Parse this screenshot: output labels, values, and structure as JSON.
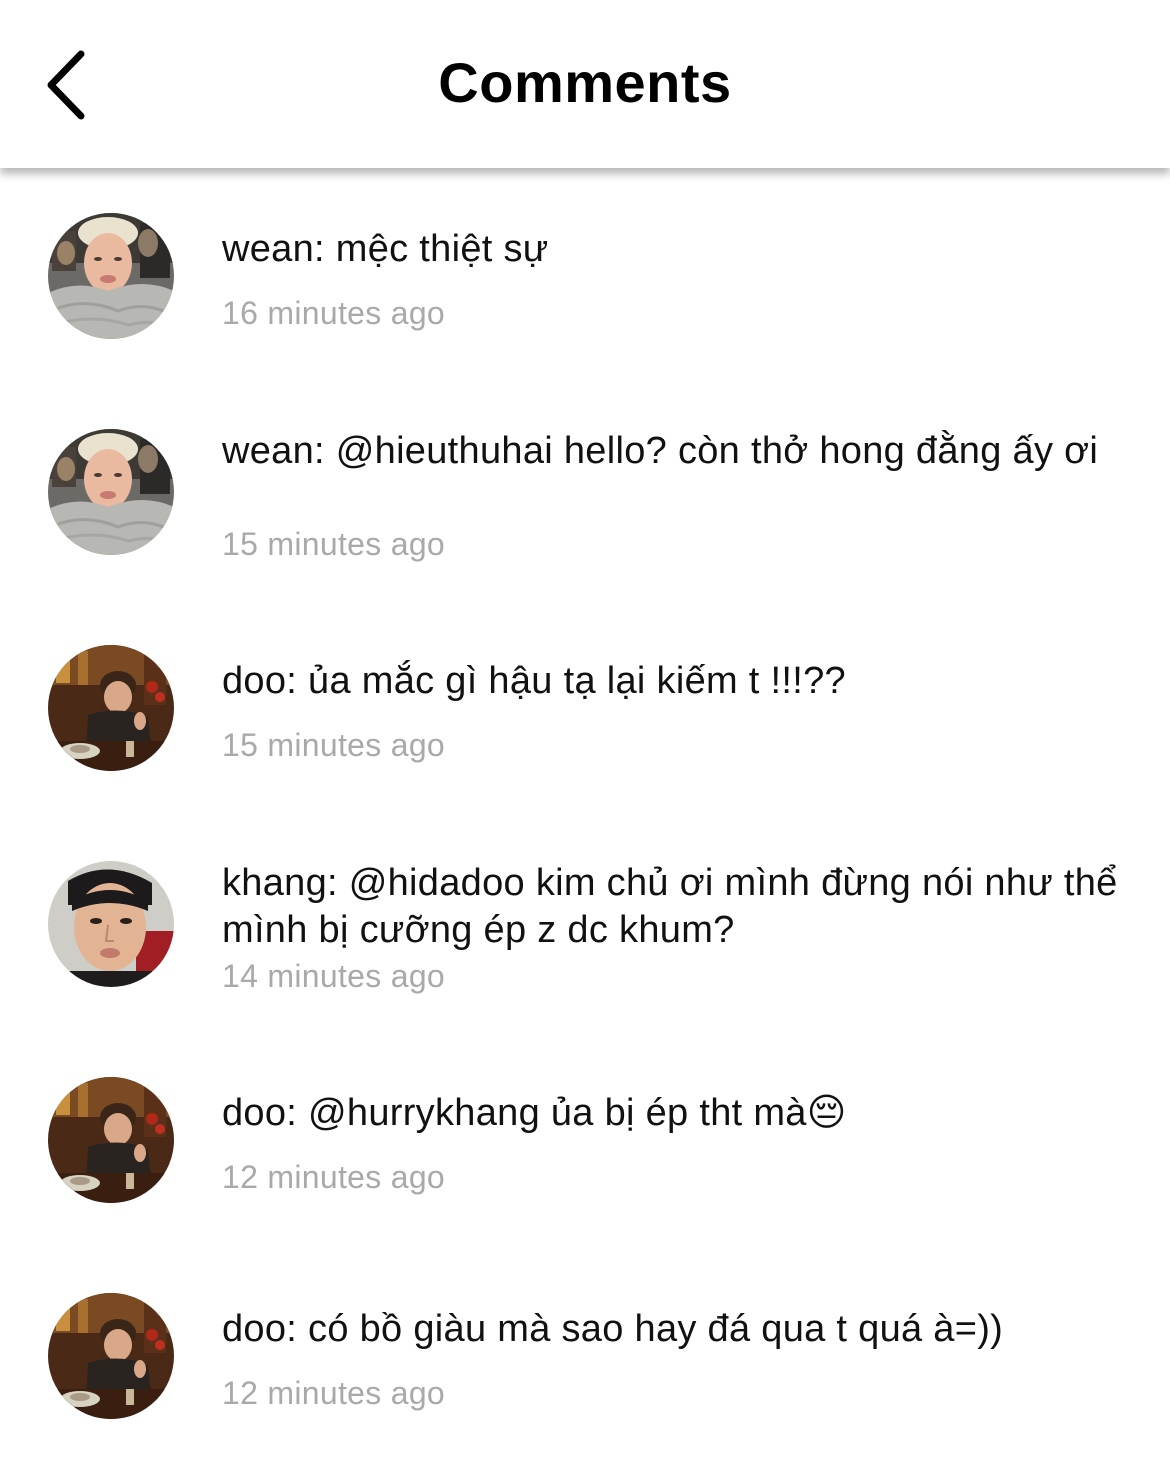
{
  "header": {
    "title": "Comments",
    "back_icon": "chevron-left-icon"
  },
  "comments": [
    {
      "author": "wean",
      "text": "wean: mệc thiệt sự",
      "time": "16 minutes ago"
    },
    {
      "author": "wean",
      "text": "wean: @hieuthuhai hello? còn thở hong đằng ấy ơi",
      "time": "15 minutes ago"
    },
    {
      "author": "doo",
      "text": "doo: ủa mắc gì hậu tạ lại kiếm t !!!??",
      "time": "15 minutes ago"
    },
    {
      "author": "khang",
      "text": "khang: @hidadoo kim chủ ơi mình đừng nói như thể mình bị cưỡng ép z dc khum?",
      "time": "14 minutes ago"
    },
    {
      "author": "doo",
      "text": "doo: @hurrykhang ủa bị ép tht mà😔",
      "time": "12 minutes ago"
    },
    {
      "author": "doo",
      "text": "doo: có bồ giàu mà sao hay đá qua t quá à=))",
      "time": "12 minutes ago"
    }
  ]
}
